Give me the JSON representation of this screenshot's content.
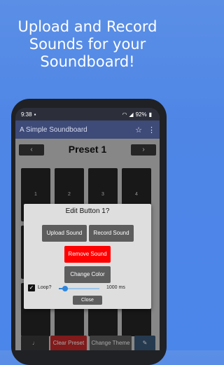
{
  "headline": [
    "Upload and Record",
    "Sounds for your",
    "Soundboard!"
  ],
  "statusbar": {
    "time": "9:38",
    "battery": "92%"
  },
  "appbar": {
    "title": "A Simple Soundboard",
    "star_icon": "star-icon",
    "menu_icon": "overflow-menu-icon"
  },
  "preset": {
    "title": "Preset 1",
    "prev": "‹",
    "next": "›"
  },
  "pads": [
    "1",
    "2",
    "3",
    "4"
  ],
  "bottom": {
    "left_icon": "music-note-icon",
    "clear": "Clear Preset",
    "theme": "Change Theme",
    "right_icon": "pencil-icon"
  },
  "dialog": {
    "title": "Edit Button 1?",
    "upload": "Upload Sound",
    "record": "Record Sound",
    "remove": "Remove Sound",
    "color": "Change Color",
    "loop_label": "Loop?",
    "loop_checked": true,
    "loop_level_percent": 15,
    "loop_value": "1000 ms",
    "close": "Close"
  },
  "colors": {
    "accent": "#3e4a78",
    "danger": "#ff0000",
    "slider": "#2e86de"
  }
}
